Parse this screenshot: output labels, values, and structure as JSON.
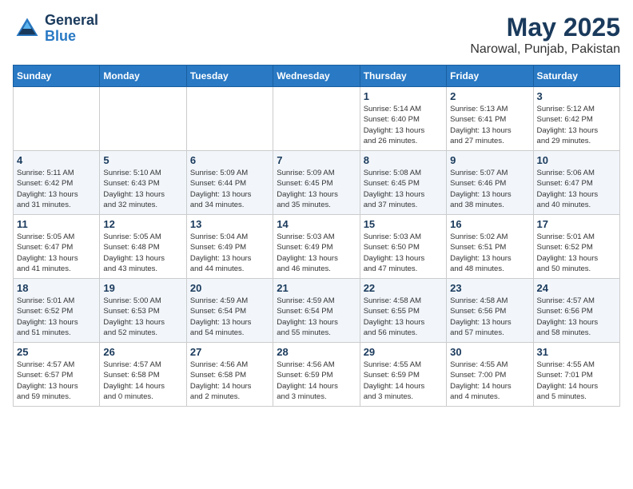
{
  "header": {
    "logo_line1": "General",
    "logo_line2": "Blue",
    "main_title": "May 2025",
    "subtitle": "Narowal, Punjab, Pakistan"
  },
  "calendar": {
    "days_of_week": [
      "Sunday",
      "Monday",
      "Tuesday",
      "Wednesday",
      "Thursday",
      "Friday",
      "Saturday"
    ],
    "weeks": [
      [
        {
          "day": "",
          "info": ""
        },
        {
          "day": "",
          "info": ""
        },
        {
          "day": "",
          "info": ""
        },
        {
          "day": "",
          "info": ""
        },
        {
          "day": "1",
          "info": "Sunrise: 5:14 AM\nSunset: 6:40 PM\nDaylight: 13 hours\nand 26 minutes."
        },
        {
          "day": "2",
          "info": "Sunrise: 5:13 AM\nSunset: 6:41 PM\nDaylight: 13 hours\nand 27 minutes."
        },
        {
          "day": "3",
          "info": "Sunrise: 5:12 AM\nSunset: 6:42 PM\nDaylight: 13 hours\nand 29 minutes."
        }
      ],
      [
        {
          "day": "4",
          "info": "Sunrise: 5:11 AM\nSunset: 6:42 PM\nDaylight: 13 hours\nand 31 minutes."
        },
        {
          "day": "5",
          "info": "Sunrise: 5:10 AM\nSunset: 6:43 PM\nDaylight: 13 hours\nand 32 minutes."
        },
        {
          "day": "6",
          "info": "Sunrise: 5:09 AM\nSunset: 6:44 PM\nDaylight: 13 hours\nand 34 minutes."
        },
        {
          "day": "7",
          "info": "Sunrise: 5:09 AM\nSunset: 6:45 PM\nDaylight: 13 hours\nand 35 minutes."
        },
        {
          "day": "8",
          "info": "Sunrise: 5:08 AM\nSunset: 6:45 PM\nDaylight: 13 hours\nand 37 minutes."
        },
        {
          "day": "9",
          "info": "Sunrise: 5:07 AM\nSunset: 6:46 PM\nDaylight: 13 hours\nand 38 minutes."
        },
        {
          "day": "10",
          "info": "Sunrise: 5:06 AM\nSunset: 6:47 PM\nDaylight: 13 hours\nand 40 minutes."
        }
      ],
      [
        {
          "day": "11",
          "info": "Sunrise: 5:05 AM\nSunset: 6:47 PM\nDaylight: 13 hours\nand 41 minutes."
        },
        {
          "day": "12",
          "info": "Sunrise: 5:05 AM\nSunset: 6:48 PM\nDaylight: 13 hours\nand 43 minutes."
        },
        {
          "day": "13",
          "info": "Sunrise: 5:04 AM\nSunset: 6:49 PM\nDaylight: 13 hours\nand 44 minutes."
        },
        {
          "day": "14",
          "info": "Sunrise: 5:03 AM\nSunset: 6:49 PM\nDaylight: 13 hours\nand 46 minutes."
        },
        {
          "day": "15",
          "info": "Sunrise: 5:03 AM\nSunset: 6:50 PM\nDaylight: 13 hours\nand 47 minutes."
        },
        {
          "day": "16",
          "info": "Sunrise: 5:02 AM\nSunset: 6:51 PM\nDaylight: 13 hours\nand 48 minutes."
        },
        {
          "day": "17",
          "info": "Sunrise: 5:01 AM\nSunset: 6:52 PM\nDaylight: 13 hours\nand 50 minutes."
        }
      ],
      [
        {
          "day": "18",
          "info": "Sunrise: 5:01 AM\nSunset: 6:52 PM\nDaylight: 13 hours\nand 51 minutes."
        },
        {
          "day": "19",
          "info": "Sunrise: 5:00 AM\nSunset: 6:53 PM\nDaylight: 13 hours\nand 52 minutes."
        },
        {
          "day": "20",
          "info": "Sunrise: 4:59 AM\nSunset: 6:54 PM\nDaylight: 13 hours\nand 54 minutes."
        },
        {
          "day": "21",
          "info": "Sunrise: 4:59 AM\nSunset: 6:54 PM\nDaylight: 13 hours\nand 55 minutes."
        },
        {
          "day": "22",
          "info": "Sunrise: 4:58 AM\nSunset: 6:55 PM\nDaylight: 13 hours\nand 56 minutes."
        },
        {
          "day": "23",
          "info": "Sunrise: 4:58 AM\nSunset: 6:56 PM\nDaylight: 13 hours\nand 57 minutes."
        },
        {
          "day": "24",
          "info": "Sunrise: 4:57 AM\nSunset: 6:56 PM\nDaylight: 13 hours\nand 58 minutes."
        }
      ],
      [
        {
          "day": "25",
          "info": "Sunrise: 4:57 AM\nSunset: 6:57 PM\nDaylight: 13 hours\nand 59 minutes."
        },
        {
          "day": "26",
          "info": "Sunrise: 4:57 AM\nSunset: 6:58 PM\nDaylight: 14 hours\nand 0 minutes."
        },
        {
          "day": "27",
          "info": "Sunrise: 4:56 AM\nSunset: 6:58 PM\nDaylight: 14 hours\nand 2 minutes."
        },
        {
          "day": "28",
          "info": "Sunrise: 4:56 AM\nSunset: 6:59 PM\nDaylight: 14 hours\nand 3 minutes."
        },
        {
          "day": "29",
          "info": "Sunrise: 4:55 AM\nSunset: 6:59 PM\nDaylight: 14 hours\nand 3 minutes."
        },
        {
          "day": "30",
          "info": "Sunrise: 4:55 AM\nSunset: 7:00 PM\nDaylight: 14 hours\nand 4 minutes."
        },
        {
          "day": "31",
          "info": "Sunrise: 4:55 AM\nSunset: 7:01 PM\nDaylight: 14 hours\nand 5 minutes."
        }
      ]
    ]
  }
}
